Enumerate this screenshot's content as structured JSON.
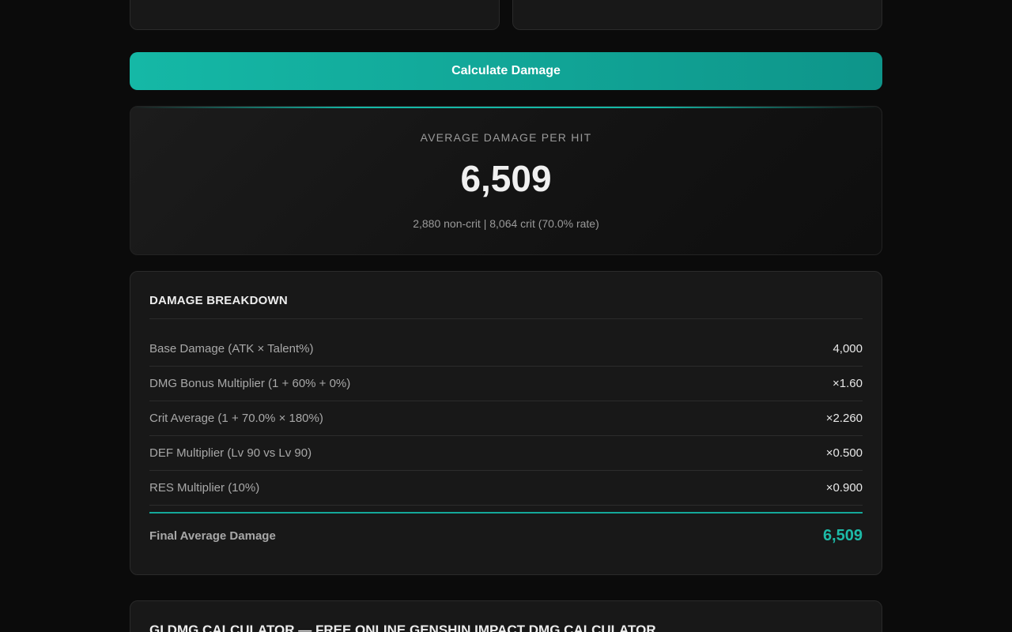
{
  "calculate_button": {
    "label": "Calculate Damage"
  },
  "result": {
    "label": "AVERAGE DAMAGE PER HIT",
    "value": "6,509",
    "sub": "2,880 non-crit | 8,064 crit (70.0% rate)"
  },
  "breakdown": {
    "title": "DAMAGE BREAKDOWN",
    "rows": [
      {
        "label": "Base Damage (ATK × Talent%)",
        "value": "4,000"
      },
      {
        "label": "DMG Bonus Multiplier (1 + 60% + 0%)",
        "value": "×1.60"
      },
      {
        "label": "Crit Average (1 + 70.0% × 180%)",
        "value": "×2.260"
      },
      {
        "label": "DEF Multiplier (Lv 90 vs Lv 90)",
        "value": "×0.500"
      },
      {
        "label": "RES Multiplier (10%)",
        "value": "×0.900"
      }
    ],
    "final": {
      "label": "Final Average Damage",
      "value": "6,509"
    }
  },
  "footer": {
    "title": "GI DMG CALCULATOR — FREE ONLINE GENSHIN IMPACT DMG CALCULATOR"
  },
  "colors": {
    "accent": "#14b8a6",
    "background": "#0b0b0b",
    "card": "#181818"
  }
}
